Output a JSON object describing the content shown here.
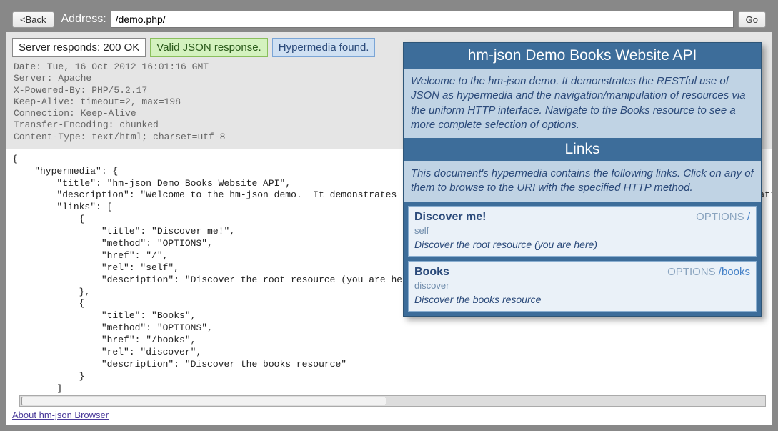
{
  "toolbar": {
    "back_label": "<Back",
    "address_label": "Address:",
    "address_value": "/demo.php/",
    "go_label": "Go"
  },
  "status": {
    "response": "Server responds: 200 OK",
    "valid": "Valid JSON response.",
    "hyper": "Hypermedia found."
  },
  "headers_text": "Date: Tue, 16 Oct 2012 16:01:16 GMT\nServer: Apache\nX-Powered-By: PHP/5.2.17\nKeep-Alive: timeout=2, max=198\nConnection: Keep-Alive\nTransfer-Encoding: chunked\nContent-Type: text/html; charset=utf-8",
  "json_text": "{\n    \"hypermedia\": {\n        \"title\": \"hm-json Demo Books Website API\",\n        \"description\": \"Welcome to the hm-json demo.  It demonstrates the RESTful use of JSON as hypermedia and the navigation/manipulation of resources via the uniform HTTP interface. Navigate to the Books resource to see a more complete selection of options.\",\n        \"links\": [\n            {\n                \"title\": \"Discover me!\",\n                \"method\": \"OPTIONS\",\n                \"href\": \"/\",\n                \"rel\": \"self\",\n                \"description\": \"Discover the root resource (you are here)\"\n            },\n            {\n                \"title\": \"Books\",\n                \"method\": \"OPTIONS\",\n                \"href\": \"/books\",\n                \"rel\": \"discover\",\n                \"description\": \"Discover the books resource\"\n            }\n        ]\n    }\n}",
  "about_label": "About hm-json Browser",
  "panel": {
    "title": "hm-json Demo Books Website API",
    "desc": "Welcome to the hm-json demo. It demonstrates the RESTful use of JSON as hypermedia and the navigation/manipulation of resources via the uniform HTTP interface. Navigate to the Books resource to see a more complete selection of options.",
    "links_heading": "Links",
    "links_intro": "This document's hypermedia contains the following links. Click on any of them to browse to the URI with the specified HTTP method.",
    "links": [
      {
        "title": "Discover me!",
        "method": "OPTIONS",
        "href": "/",
        "rel": "self",
        "description": "Discover the root resource (you are here)"
      },
      {
        "title": "Books",
        "method": "OPTIONS",
        "href": "/books",
        "rel": "discover",
        "description": "Discover the books resource"
      }
    ]
  }
}
